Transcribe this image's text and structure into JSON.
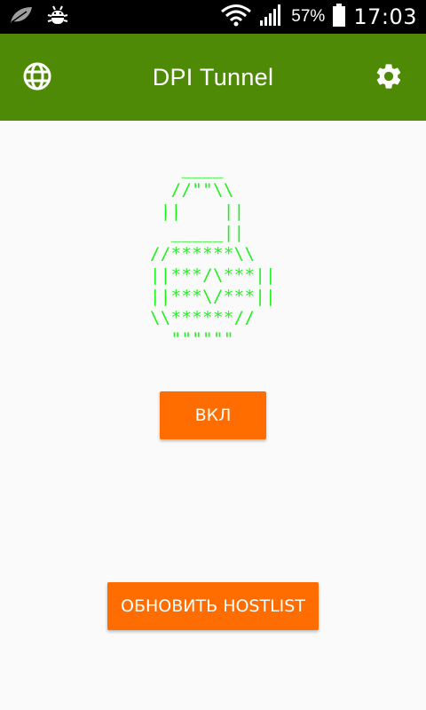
{
  "status_bar": {
    "battery_percent": "57%",
    "time": "17:03",
    "icons": [
      "leaf-icon",
      "android-debug-icon",
      "wifi-icon",
      "signal-icon",
      "battery-icon"
    ]
  },
  "app_bar": {
    "title": "DPI Tunnel",
    "background_color": "#4e8a06",
    "left_icon": "globe-icon",
    "right_icon": "gear-icon"
  },
  "lock_art": {
    "color": "#1df21d",
    "text": "   ____\n  //\"\"\\\\\n ||    ||\n  _____||\n//******\\\\\n||***/\\***||\n||***\\/***||\n\\\\******//\n  \"\"\"\"\"\""
  },
  "buttons": {
    "toggle_label": "ВКЛ",
    "update_hostlist_label": "ОБНОВИТЬ HOSTLIST",
    "accent_color": "#ff6d00"
  }
}
